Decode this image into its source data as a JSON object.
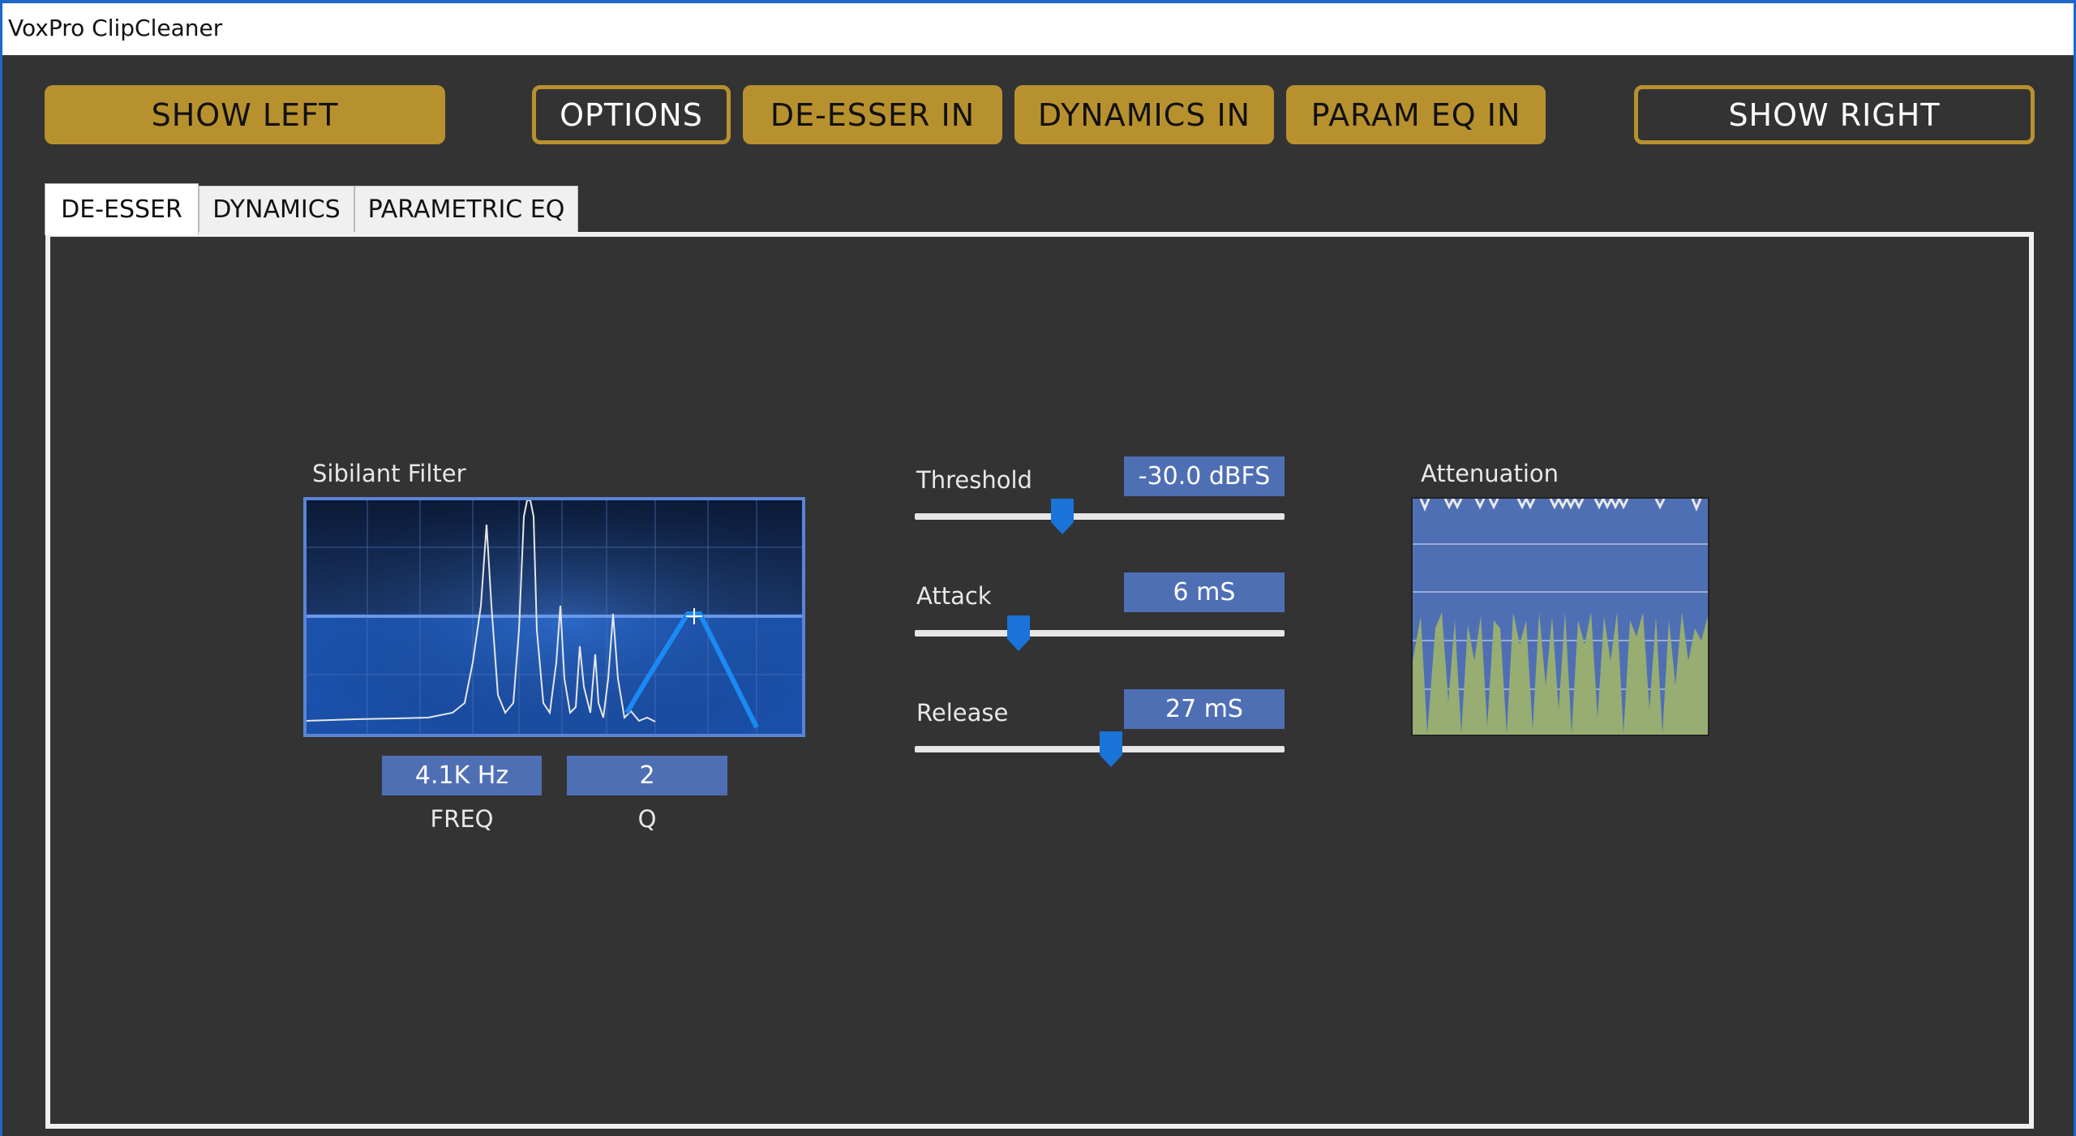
{
  "window": {
    "title": "VoxPro ClipCleaner"
  },
  "toolbar": {
    "show_left": "SHOW LEFT",
    "options": "OPTIONS",
    "de_esser_in": "DE-ESSER IN",
    "dynamics_in": "DYNAMICS IN",
    "param_eq_in": "PARAM EQ IN",
    "show_right": "SHOW RIGHT"
  },
  "tabs": [
    {
      "label": "DE-ESSER",
      "active": true
    },
    {
      "label": "DYNAMICS",
      "active": false
    },
    {
      "label": "PARAMETRIC EQ",
      "active": false
    }
  ],
  "sibilant_filter": {
    "title": "Sibilant Filter",
    "freq_value": "4.1K Hz",
    "freq_label": "FREQ",
    "q_value": "2",
    "q_label": "Q"
  },
  "controls": {
    "threshold": {
      "label": "Threshold",
      "value": "-30.0 dBFS",
      "position": 0.4
    },
    "attack": {
      "label": "Attack",
      "value": "6 mS",
      "position": 0.28
    },
    "release": {
      "label": "Release",
      "value": "27 mS",
      "position": 0.53
    }
  },
  "attenuation": {
    "title": "Attenuation"
  },
  "colors": {
    "gold": "#b8912f",
    "panel_bg": "#333333",
    "value_box": "#4f6fb5",
    "slider_thumb": "#1a73d8",
    "atten_fill": "#97ad72"
  }
}
